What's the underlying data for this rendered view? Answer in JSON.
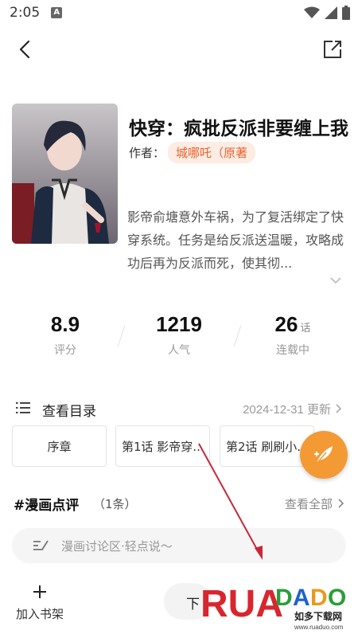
{
  "status_bar": {
    "time": "2:05",
    "notif_icon": "A"
  },
  "book": {
    "title": "快穿：疯批反派非要缠上我",
    "author_label": "作者：",
    "author_name": "城哪吒（原著",
    "synopsis": "影帝俞塘意外车祸，为了复活绑定了快穿系统。任务是给反派送温暖，攻略成功后再为反派而死，使其彻..."
  },
  "stats": [
    {
      "value": "8.9",
      "unit": "",
      "label": "评分"
    },
    {
      "value": "1219",
      "unit": "",
      "label": "人气"
    },
    {
      "value": "26",
      "unit": "话",
      "label": "连载中"
    }
  ],
  "catalog": {
    "label": "查看目录",
    "updated": "2024-12-31 更新",
    "chapters": [
      "序章",
      "第1话 影帝穿...",
      "第2话 刷刷小..."
    ]
  },
  "comments": {
    "title": "#漫画点评",
    "count": "（1条）",
    "view_all": "查看全部",
    "placeholder": "漫画讨论区·轻点说～"
  },
  "bottom_bar": {
    "add_to_shelf": "加入书架",
    "download_partial": "下"
  },
  "watermark": {
    "logo": "RUADADO",
    "subtitle": "如多下载网",
    "url": "www.ruaduo.com"
  },
  "colors": {
    "accent_orange": "#e8632e",
    "fab_orange": "#f39a35",
    "annotation_red": "#c8283a"
  }
}
